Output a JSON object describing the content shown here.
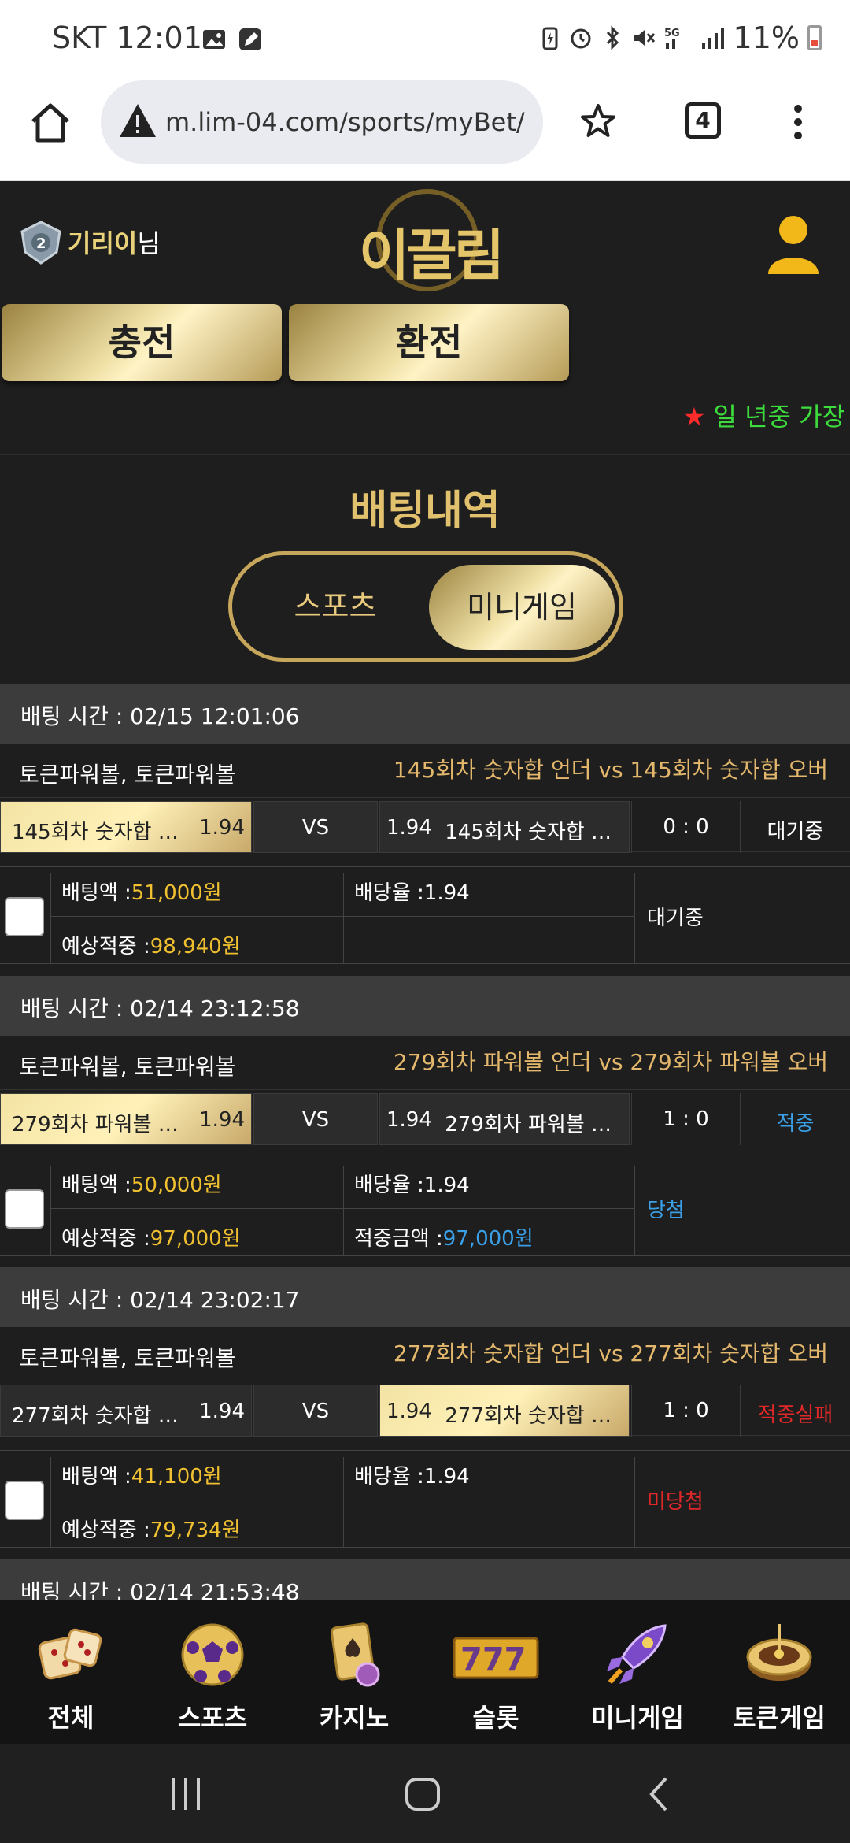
{
  "status_bar": {
    "time": "SKT 12:01",
    "battery": "11%"
  },
  "browser": {
    "url": "m.lim-04.com/sports/myBet/",
    "tab_count": "4"
  },
  "header": {
    "user_name": "기리이",
    "user_suffix": "님",
    "logo_text": "이끌림"
  },
  "actions": {
    "deposit": "충전",
    "withdraw": "환전"
  },
  "marquee": {
    "star": "★",
    "text": "일 년중 가장"
  },
  "page": {
    "title": "배팅내역",
    "tabs": [
      "스포츠",
      "미니게임"
    ],
    "active_tab": "미니게임"
  },
  "labels": {
    "bet_amount": "배팅액 :",
    "odds": "배당율 :",
    "expected": "예상적중 :",
    "win_amount": "적중금액 :",
    "vs": "VS"
  },
  "bets": [
    {
      "time": "배팅 시간 : 02/15 12:01:06",
      "league": "토큰파워볼, 토큰파워볼",
      "match": "145회차 숫자합 언더  vs  145회차 숫자합 오버",
      "home": "145회차 숫자합 …",
      "home_odds": "1.94",
      "away": "145회차 숫자합 …",
      "away_odds": "1.94",
      "selected": "home",
      "score": "0 : 0",
      "status": "대기중",
      "status_color": "#ffffff",
      "amount": "51,000원",
      "odds": "1.94",
      "expected": "98,940원",
      "win_amount": "",
      "result": "대기중",
      "result_color": "#ffffff"
    },
    {
      "time": "배팅 시간 : 02/14 23:12:58",
      "league": "토큰파워볼, 토큰파워볼",
      "match": "279회차 파워볼 언더  vs  279회차 파워볼 오버",
      "home": "279회차 파워볼 …",
      "home_odds": "1.94",
      "away": "279회차 파워볼 …",
      "away_odds": "1.94",
      "selected": "home",
      "score": "1 : 0",
      "status": "적중",
      "status_color": "#3aa0e8",
      "amount": "50,000원",
      "odds": "1.94",
      "expected": "97,000원",
      "win_amount": "97,000원",
      "result": "당첨",
      "result_color": "#3aa0e8"
    },
    {
      "time": "배팅 시간 : 02/14 23:02:17",
      "league": "토큰파워볼, 토큰파워볼",
      "match": "277회차 숫자합 언더  vs  277회차 숫자합 오버",
      "home": "277회차 숫자합 …",
      "home_odds": "1.94",
      "away": "277회차 숫자합 …",
      "away_odds": "1.94",
      "selected": "away",
      "score": "1 : 0",
      "status": "적중실패",
      "status_color": "#e0282a",
      "amount": "41,100원",
      "odds": "1.94",
      "expected": "79,734원",
      "win_amount": "",
      "result": "미당첨",
      "result_color": "#e0282a"
    }
  ],
  "next_bet_time": "배팅 시간 : 02/14 21:53:48",
  "bottom_nav": [
    {
      "label": "전체",
      "icon": "dice-icon"
    },
    {
      "label": "스포츠",
      "icon": "soccer-ball-icon"
    },
    {
      "label": "카지노",
      "icon": "cards-icon"
    },
    {
      "label": "슬롯",
      "icon": "slot-777-icon"
    },
    {
      "label": "미니게임",
      "icon": "rocket-icon"
    },
    {
      "label": "토큰게임",
      "icon": "roulette-icon"
    }
  ]
}
